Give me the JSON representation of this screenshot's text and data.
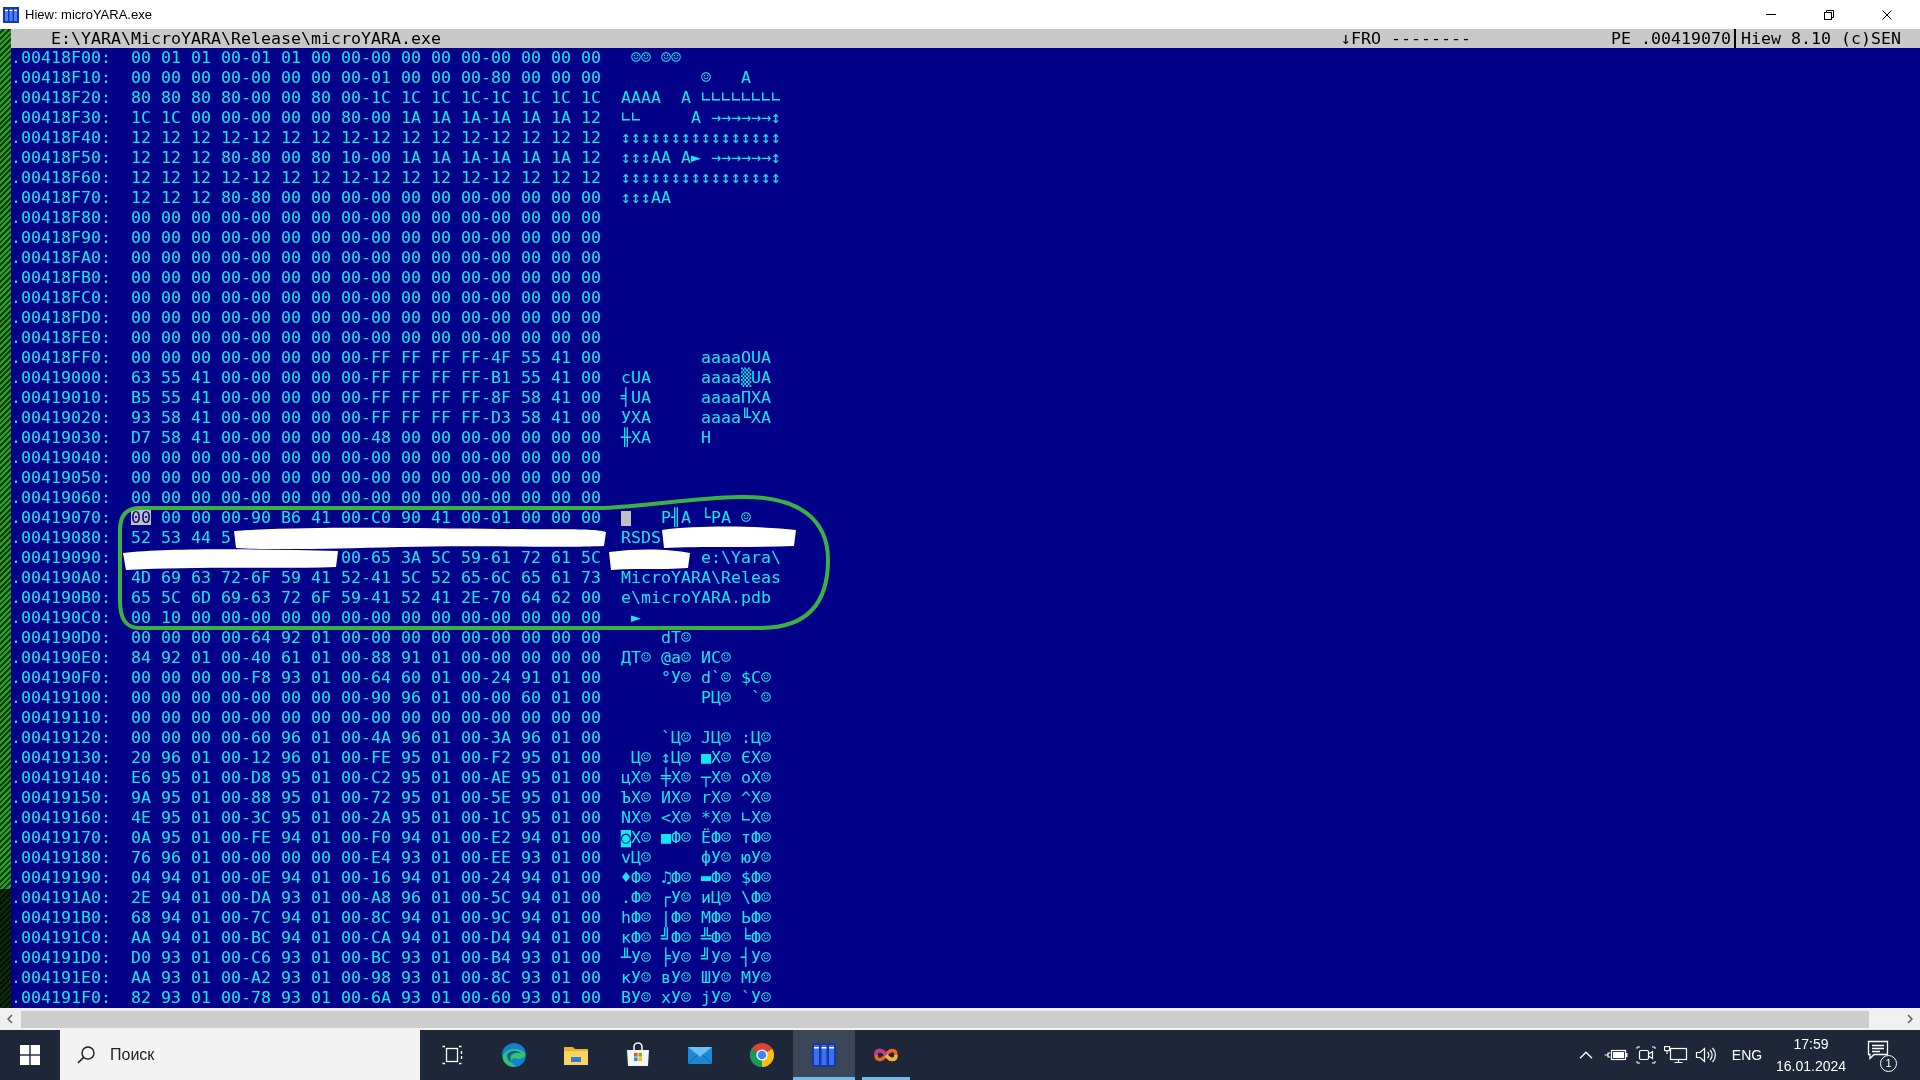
{
  "window": {
    "title": "Hiew: microYARA.exe"
  },
  "header": {
    "file_path": "E:\\YARA\\MicroYARA\\Release\\microYARA.exe",
    "flags": "↓FRO --------",
    "offset": "PE .00419070",
    "version": "Hiew 8.10 (c)SEN"
  },
  "rows": [
    {
      "address": ".00418F00:",
      "hex": "00 01 01 00-01 01 00 00-00 00 00 00-00 00 00 00",
      "ascii": " ☺☺ ☺☺",
      "selected": false
    },
    {
      "address": ".00418F10:",
      "hex": "00 00 00 00-00 00 00 00-01 00 00 00-80 00 00 00",
      "ascii": "        ☺   А",
      "selected": false
    },
    {
      "address": ".00418F20:",
      "hex": "80 80 80 80-00 00 80 00-1C 1C 1C 1C-1C 1C 1C 1C",
      "ascii": "АААА  А ∟∟∟∟∟∟∟∟",
      "selected": false
    },
    {
      "address": ".00418F30:",
      "hex": "1C 1C 00 00-00 00 00 80-00 1A 1A 1A-1A 1A 1A 12",
      "ascii": "∟∟     А →→→→→→↕",
      "selected": false
    },
    {
      "address": ".00418F40:",
      "hex": "12 12 12 12-12 12 12 12-12 12 12 12-12 12 12 12",
      "ascii": "↕↕↕↕↕↕↕↕↕↕↕↕↕↕↕↕",
      "selected": false
    },
    {
      "address": ".00418F50:",
      "hex": "12 12 12 80-80 00 80 10-00 1A 1A 1A-1A 1A 1A 12",
      "ascii": "↕↕↕АА А► →→→→→→↕",
      "selected": false
    },
    {
      "address": ".00418F60:",
      "hex": "12 12 12 12-12 12 12 12-12 12 12 12-12 12 12 12",
      "ascii": "↕↕↕↕↕↕↕↕↕↕↕↕↕↕↕↕",
      "selected": false
    },
    {
      "address": ".00418F70:",
      "hex": "12 12 12 80-80 00 00 00-00 00 00 00-00 00 00 00",
      "ascii": "↕↕↕АА",
      "selected": false
    },
    {
      "address": ".00418F80:",
      "hex": "00 00 00 00-00 00 00 00-00 00 00 00-00 00 00 00",
      "selected": false
    },
    {
      "address": ".00418F90:",
      "hex": "00 00 00 00-00 00 00 00-00 00 00 00-00 00 00 00",
      "selected": false
    },
    {
      "address": ".00418FA0:",
      "hex": "00 00 00 00-00 00 00 00-00 00 00 00-00 00 00 00",
      "selected": false
    },
    {
      "address": ".00418FB0:",
      "hex": "00 00 00 00-00 00 00 00-00 00 00 00-00 00 00 00",
      "selected": false
    },
    {
      "address": ".00418FC0:",
      "hex": "00 00 00 00-00 00 00 00-00 00 00 00-00 00 00 00",
      "selected": false
    },
    {
      "address": ".00418FD0:",
      "hex": "00 00 00 00-00 00 00 00-00 00 00 00-00 00 00 00",
      "selected": false
    },
    {
      "address": ".00418FE0:",
      "hex": "00 00 00 00-00 00 00 00-00 00 00 00-00 00 00 00",
      "selected": false
    },
    {
      "address": ".00418FF0:",
      "hex": "00 00 00 00-00 00 00 00-FF FF FF FF-4F 55 41 00",
      "ascii": "        aaaaOUA",
      "selected": false
    },
    {
      "address": ".00419000:",
      "hex": "63 55 41 00-00 00 00 00-FF FF FF FF-B1 55 41 00",
      "ascii": "cUA     aaaa▒UA",
      "selected": false
    },
    {
      "address": ".00419010:",
      "hex": "B5 55 41 00-00 00 00 00-FF FF FF FF-8F 58 41 00",
      "ascii": "╡UA     aaaaПXA",
      "selected": false
    },
    {
      "address": ".00419020:",
      "hex": "93 58 41 00-00 00 00 00-FF FF FF FF-D3 58 41 00",
      "ascii": "УXA     aaaa╙XA",
      "selected": false
    },
    {
      "address": ".00419030:",
      "hex": "D7 58 41 00-00 00 00 00-48 00 00 00-00 00 00 00",
      "ascii": "╫XA     H",
      "selected": false
    },
    {
      "address": ".00419040:",
      "hex": "00 00 00 00-00 00 00 00-00 00 00 00-00 00 00 00",
      "selected": false
    },
    {
      "address": ".00419050:",
      "hex": "00 00 00 00-00 00 00 00-00 00 00 00-00 00 00 00",
      "selected": false
    },
    {
      "address": ".00419060:",
      "hex": "00 00 00 00-00 00 00 00-00 00 00 00-00 00 00 00",
      "selected": false
    },
    {
      "address": ".00419070:",
      "hex": "00 00 00 00-90 B6 41 00-C0 90 41 00-01 00 00 00",
      "ascii": "    Р╢A └РA ☺",
      "selected": true
    },
    {
      "address": ".00419080:",
      "hex": "52 53 44 5",
      "ascii": "RSDS",
      "selected": false
    },
    {
      "address": ".00419090:",
      "hex": "                     00-65 3A 5C 59-61 72 61 5C",
      "ascii": "        e:\\Yara\\",
      "selected": false
    },
    {
      "address": ".004190A0:",
      "hex": "4D 69 63 72-6F 59 41 52-41 5C 52 65-6C 65 61 73",
      "ascii": "MicroYARA\\Releas",
      "selected": false
    },
    {
      "address": ".004190B0:",
      "hex": "65 5C 6D 69-63 72 6F 59-41 52 41 2E-70 64 62 00",
      "ascii": "e\\microYARA.pdb",
      "selected": false
    },
    {
      "address": ".004190C0:",
      "hex": "00 10 00 00-00 00 00 00-00 00 00 00-00 00 00 00",
      "ascii": " ►",
      "selected": false
    },
    {
      "address": ".004190D0:",
      "hex": "00 00 00 00-64 92 01 00-00 00 00 00-00 00 00 00",
      "ascii": "    dТ☺",
      "selected": false
    },
    {
      "address": ".004190E0:",
      "hex": "84 92 01 00-40 61 01 00-88 91 01 00-00 00 00 00",
      "ascii": "ДТ☺ @a☺ ИС☺",
      "selected": false
    },
    {
      "address": ".004190F0:",
      "hex": "00 00 00 00-F8 93 01 00-64 60 01 00-24 91 01 00",
      "ascii": "    °У☺ d`☺ $С☺",
      "selected": false
    },
    {
      "address": ".00419100:",
      "hex": "00 00 00 00-00 00 00 00-90 96 01 00-00 60 01 00",
      "ascii": "        РЦ☺  `☺",
      "selected": false
    },
    {
      "address": ".00419110:",
      "hex": "00 00 00 00-00 00 00 00-00 00 00 00-00 00 00 00",
      "selected": false
    },
    {
      "address": ".00419120:",
      "hex": "00 00 00 00-60 96 01 00-4A 96 01 00-3A 96 01 00",
      "ascii": "    `Ц☺ JЦ☺ :Ц☺",
      "selected": false
    },
    {
      "address": ".00419130:",
      "hex": "20 96 01 00-12 96 01 00-FE 95 01 00-F2 95 01 00",
      "ascii": " Ц☺ ↕Ц☺ ■Х☺ ЄХ☺",
      "selected": false
    },
    {
      "address": ".00419140:",
      "hex": "E6 95 01 00-D8 95 01 00-C2 95 01 00-AE 95 01 00",
      "ascii": "цХ☺ ╪Х☺ ┬Х☺ оХ☺",
      "selected": false
    },
    {
      "address": ".00419150:",
      "hex": "9A 95 01 00-88 95 01 00-72 95 01 00-5E 95 01 00",
      "ascii": "ЪХ☺ ИХ☺ rХ☺ ^Х☺",
      "selected": false
    },
    {
      "address": ".00419160:",
      "hex": "4E 95 01 00-3C 95 01 00-2A 95 01 00-1C 95 01 00",
      "ascii": "NХ☺ <Х☺ *Х☺ ∟Х☺",
      "selected": false
    },
    {
      "address": ".00419170:",
      "hex": "0A 95 01 00-FE 94 01 00-F0 94 01 00-E2 94 01 00",
      "ascii": "◙Х☺ ■Ф☺ ЁФ☺ тФ☺",
      "selected": false
    },
    {
      "address": ".00419180:",
      "hex": "76 96 01 00-00 00 00 00-E4 93 01 00-EE 93 01 00",
      "ascii": "vЦ☺     фУ☺ юУ☺",
      "selected": false
    },
    {
      "address": ".00419190:",
      "hex": "04 94 01 00-0E 94 01 00-16 94 01 00-24 94 01 00",
      "ascii": "♦Ф☺ ♫Ф☺ ▬Ф☺ $Ф☺",
      "selected": false
    },
    {
      "address": ".004191A0:",
      "hex": "2E 94 01 00-DA 93 01 00-A8 96 01 00-5C 94 01 00",
      "ascii": ".Ф☺ ┌У☺ иЦ☺ \\Ф☺",
      "selected": false
    },
    {
      "address": ".004191B0:",
      "hex": "68 94 01 00-7C 94 01 00-8C 94 01 00-9C 94 01 00",
      "ascii": "hФ☺ |Ф☺ МФ☺ ЬФ☺",
      "selected": false
    },
    {
      "address": ".004191C0:",
      "hex": "AA 94 01 00-BC 94 01 00-CA 94 01 00-D4 94 01 00",
      "ascii": "кФ☺ ╝Ф☺ ╩Ф☺ ╘Ф☺",
      "selected": false
    },
    {
      "address": ".004191D0:",
      "hex": "D0 93 01 00-C6 93 01 00-BC 93 01 00-B4 93 01 00",
      "ascii": "╨У☺ ╞У☺ ╝У☺ ┤У☺",
      "selected": false
    },
    {
      "address": ".004191E0:",
      "hex": "AA 93 01 00-A2 93 01 00-98 93 01 00-8C 93 01 00",
      "ascii": "кУ☺ вУ☺ ШУ☺ МУ☺",
      "selected": false
    },
    {
      "address": ".004191F0:",
      "hex": "82 93 01 00-78 93 01 00-6A 93 01 00-60 93 01 00",
      "ascii": "ВУ☺ xУ☺ jУ☺ `У☺",
      "selected": false
    }
  ],
  "taskbar": {
    "search": {
      "placeholder": "Поиск"
    },
    "apps": [
      {
        "kind": "swirl",
        "selected": false,
        "running": false
      },
      {
        "kind": "folder",
        "selected": false,
        "running": false
      },
      {
        "kind": "bag",
        "selected": false,
        "running": false
      },
      {
        "kind": "envelope",
        "selected": false,
        "running": false
      },
      {
        "kind": "ring",
        "selected": false,
        "running": false
      },
      {
        "kind": "panels",
        "selected": true,
        "running": true
      },
      {
        "kind": "knot",
        "selected": false,
        "running": true
      }
    ],
    "tray": {
      "language": "ENG",
      "time": "17:59",
      "date": "16.01.2024",
      "notification_count": "1"
    }
  }
}
